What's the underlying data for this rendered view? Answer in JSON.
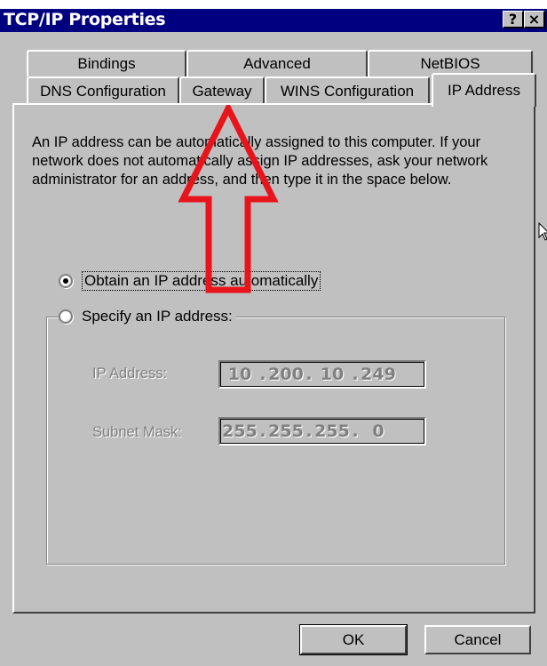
{
  "window": {
    "title": "TCP/IP Properties",
    "help_button": "?",
    "close_button": "×"
  },
  "tabs": {
    "row1": [
      {
        "label": "Bindings"
      },
      {
        "label": "Advanced"
      },
      {
        "label": "NetBIOS"
      }
    ],
    "row2": [
      {
        "label": "DNS Configuration"
      },
      {
        "label": "Gateway"
      },
      {
        "label": "WINS Configuration"
      },
      {
        "label": "IP Address",
        "active": true
      }
    ]
  },
  "description": "An IP address can be automatically assigned to this computer. If your network does not automatically assign IP addresses, ask your network administrator for an address, and then type it in the space below.",
  "options": {
    "obtain_auto": {
      "label": "Obtain an IP address automatically",
      "selected": true
    },
    "specify": {
      "label": "Specify an IP address:",
      "selected": false
    }
  },
  "fields": {
    "ip_address": {
      "label": "IP Address:",
      "octets": [
        "10",
        "200",
        "10",
        "249"
      ]
    },
    "subnet_mask": {
      "label": "Subnet Mask:",
      "octets": [
        "255",
        "255",
        "255",
        "0"
      ]
    }
  },
  "buttons": {
    "ok": "OK",
    "cancel": "Cancel"
  },
  "annotation": {
    "color": "#e8141b",
    "icon": "arrow-up-outline"
  }
}
